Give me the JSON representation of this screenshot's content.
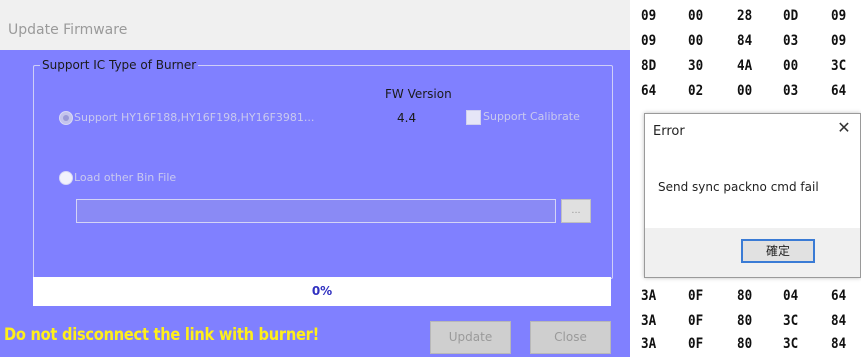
{
  "window": {
    "title": "Update Firmware",
    "group_title": "Support IC Type of Burner",
    "fw_version_label": "FW Version",
    "fw_version_value": "4.4",
    "option_support_label": "Support HY16F188,HY16F198,HY16F3981...",
    "support_calibrate_label": "Support Calibrate",
    "option_load_label": "Load other Bin File",
    "file_path_value": "",
    "browse_label": "...",
    "progress_text": "0%",
    "progress_value": 0,
    "warning_text": "Do not disconnect the link with burner!",
    "update_label": "Update",
    "close_label": "Close"
  },
  "hex_rows": [
    [
      "09",
      "00",
      "28",
      "0D",
      "09"
    ],
    [
      "09",
      "00",
      "84",
      "03",
      "09"
    ],
    [
      "8D",
      "30",
      "4A",
      "00",
      "3C"
    ],
    [
      "64",
      "02",
      "00",
      "03",
      "64"
    ],
    [
      "3A",
      "0F",
      "80",
      "04",
      "64"
    ],
    [
      "3A",
      "0F",
      "80",
      "3C",
      "84"
    ],
    [
      "3A",
      "0F",
      "80",
      "3C",
      "84"
    ]
  ],
  "dialog": {
    "title": "Error",
    "message": "Send sync packno cmd fail",
    "ok_label": "確定"
  },
  "colors": {
    "panel": "#8080ff",
    "warning": "#ffef1a",
    "dialog_accent": "#3a7bd5"
  }
}
